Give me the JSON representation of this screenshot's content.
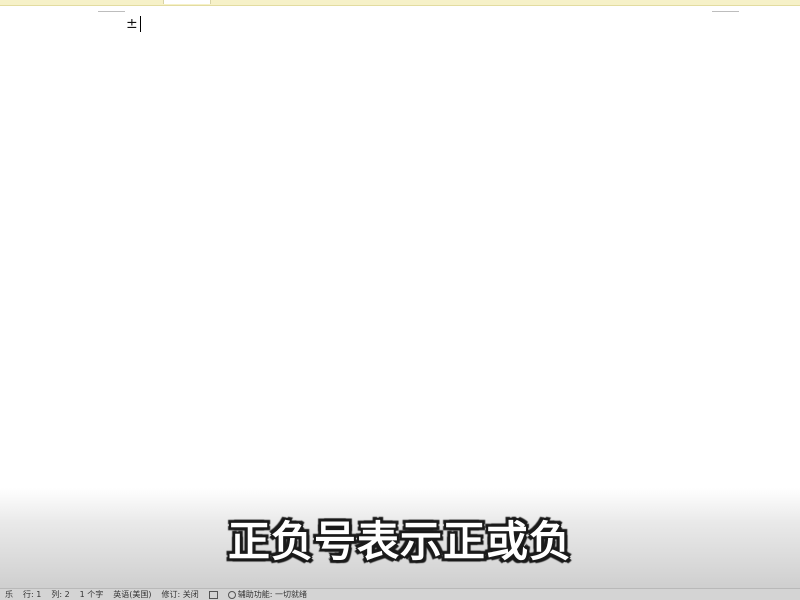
{
  "document": {
    "text": "±"
  },
  "subtitle": {
    "text": "正负号表示正或负"
  },
  "statusbar": {
    "view": "乐",
    "line": "行: 1",
    "column": "列: 2",
    "char_count": "1 个字",
    "language": "英语(美国)",
    "track_changes": "修订: 关闭",
    "accessibility": "辅助功能: 一切就绪"
  },
  "icons": {
    "macro": "macro-record-icon",
    "accessibility": "accessibility-icon"
  },
  "colors": {
    "top_strip": "#f6f1c8",
    "statusbar": "#d4d4d4",
    "subtitle_fill": "#ffffff",
    "subtitle_outline": "#1a1a1a"
  }
}
